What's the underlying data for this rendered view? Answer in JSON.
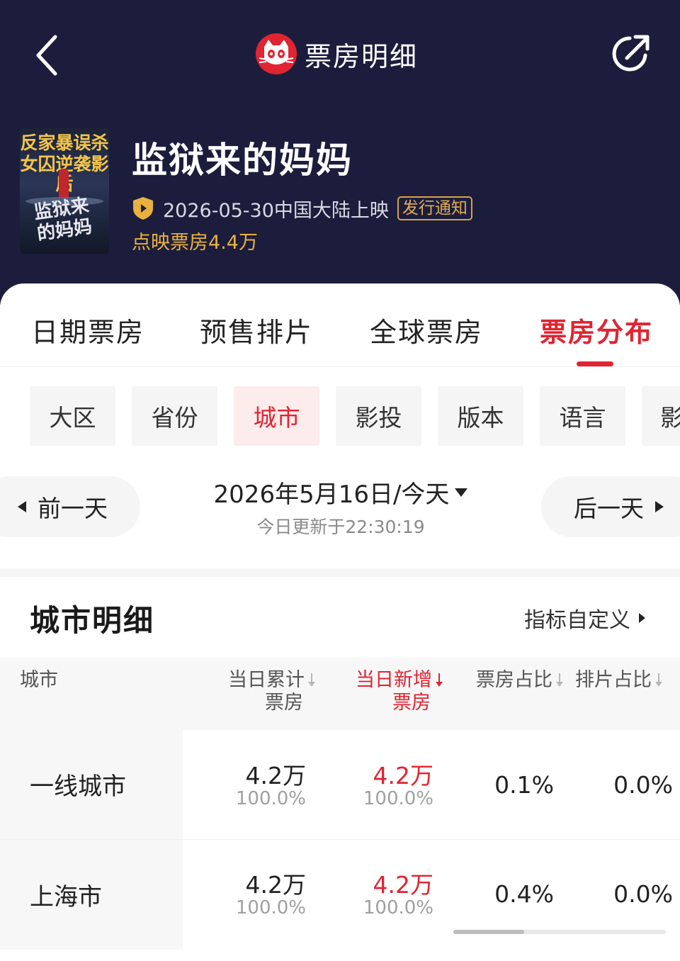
{
  "header": {
    "title": "票房明细",
    "back_icon": "chevron-left-icon",
    "share_icon": "share-arrow-icon",
    "logo_icon": "cat-logo-icon",
    "bg_color": "#1c1d3d"
  },
  "movie": {
    "poster_lines": [
      "反家暴误杀",
      "女囚逆袭影后"
    ],
    "poster_title": "监狱来的妈妈",
    "title": "监狱来的妈妈",
    "release_text": "2026-05-30中国大陆上映",
    "notice_badge": "发行通知",
    "preview_box_office": "点映票房4.4万",
    "accent_color": "#e9b23f"
  },
  "tabs": [
    {
      "label": "日期票房",
      "active": false
    },
    {
      "label": "预售排片",
      "active": false
    },
    {
      "label": "全球票房",
      "active": false
    },
    {
      "label": "票房分布",
      "active": true
    }
  ],
  "chips": [
    {
      "label": "大区",
      "active": false
    },
    {
      "label": "省份",
      "active": false
    },
    {
      "label": "城市",
      "active": true
    },
    {
      "label": "影投",
      "active": false
    },
    {
      "label": "版本",
      "active": false
    },
    {
      "label": "语言",
      "active": false
    },
    {
      "label": "影",
      "active": false
    }
  ],
  "date_nav": {
    "prev_label": "前一天",
    "next_label": "后一天",
    "date_label": "2026年5月16日/今天",
    "update_text": "今日更新于22:30:19"
  },
  "section": {
    "title": "城市明细",
    "customize_label": "指标自定义"
  },
  "table": {
    "headers": {
      "city": "城市",
      "cumulative_line1": "当日累计",
      "cumulative_line2": "票房",
      "new_line1": "当日新增",
      "new_line2": "票房",
      "box_share": "票房占比",
      "schedule_share": "排片占比"
    },
    "rows": [
      {
        "city": "一线城市",
        "cumulative": "4.2万",
        "cumulative_pct": "100.0%",
        "new": "4.2万",
        "new_pct": "100.0%",
        "box_share": "0.1%",
        "schedule_share": "0.0%"
      },
      {
        "city": "上海市",
        "cumulative": "4.2万",
        "cumulative_pct": "100.0%",
        "new": "4.2万",
        "new_pct": "100.0%",
        "box_share": "0.4%",
        "schedule_share": "0.0%"
      }
    ]
  },
  "colors": {
    "brand_red": "#e02432",
    "header_bg": "#1c1d3d",
    "gold": "#e9b23f"
  }
}
